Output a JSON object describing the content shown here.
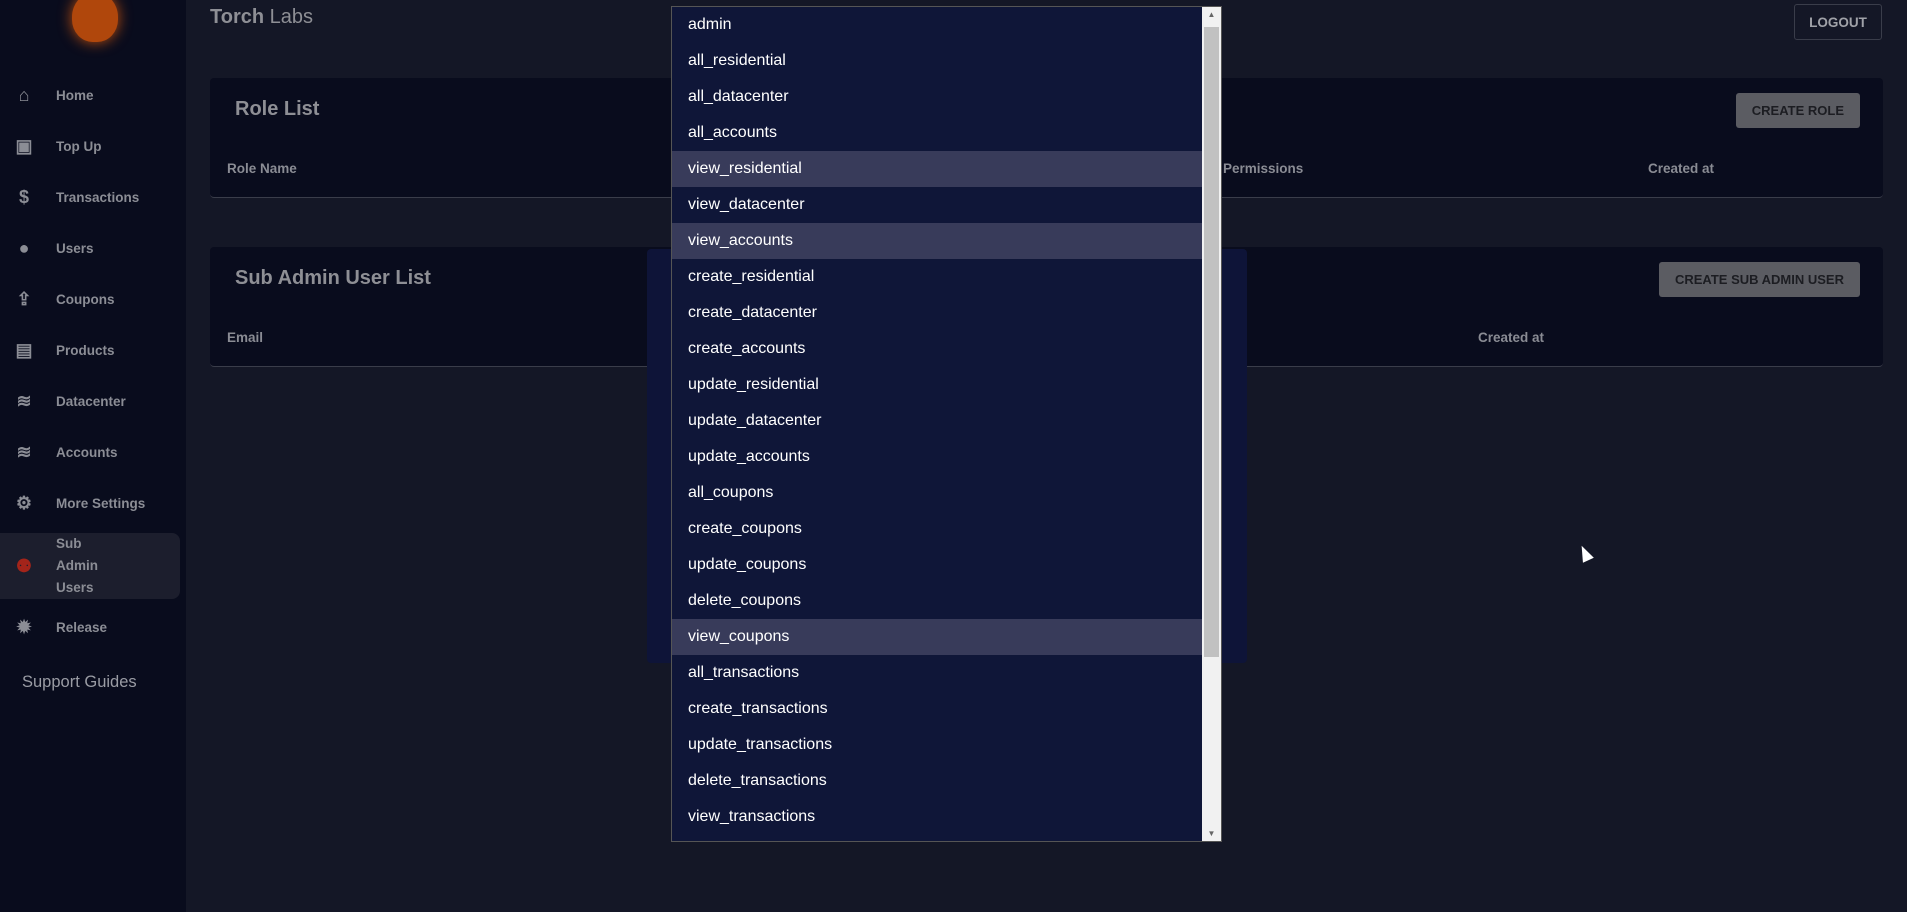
{
  "brand": {
    "bold": "Torch",
    "light": "Labs"
  },
  "header": {
    "logout": "LOGOUT"
  },
  "sidebar": {
    "items": [
      {
        "label": "Home",
        "icon": "⌂"
      },
      {
        "label": "Top Up",
        "icon": "▣"
      },
      {
        "label": "Transactions",
        "icon": "$"
      },
      {
        "label": "Users",
        "icon": "●"
      },
      {
        "label": "Coupons",
        "icon": "⇪"
      },
      {
        "label": "Products",
        "icon": "▤"
      },
      {
        "label": "Datacenter",
        "icon": "≋"
      },
      {
        "label": "Accounts",
        "icon": "≋"
      },
      {
        "label": "More Settings",
        "icon": "⚙"
      },
      {
        "label": "Sub Admin Users",
        "icon": "⚉"
      },
      {
        "label": "Release",
        "icon": "✹"
      }
    ],
    "support": "Support Guides"
  },
  "role_list": {
    "title": "Role List",
    "button": "CREATE ROLE",
    "columns": [
      "Role Name",
      "Permissions",
      "Created at"
    ]
  },
  "sub_admin_list": {
    "title": "Sub Admin User List",
    "button": "CREATE SUB ADMIN USER",
    "columns": [
      "Email",
      "Created at"
    ]
  },
  "dropdown": {
    "options": [
      "admin",
      "all_residential",
      "all_datacenter",
      "all_accounts",
      "view_residential",
      "view_datacenter",
      "view_accounts",
      "create_residential",
      "create_datacenter",
      "create_accounts",
      "update_residential",
      "update_datacenter",
      "update_accounts",
      "all_coupons",
      "create_coupons",
      "update_coupons",
      "delete_coupons",
      "view_coupons",
      "all_transactions",
      "create_transactions",
      "update_transactions",
      "delete_transactions",
      "view_transactions"
    ],
    "selected": [
      "view_residential",
      "view_accounts",
      "view_coupons"
    ]
  }
}
